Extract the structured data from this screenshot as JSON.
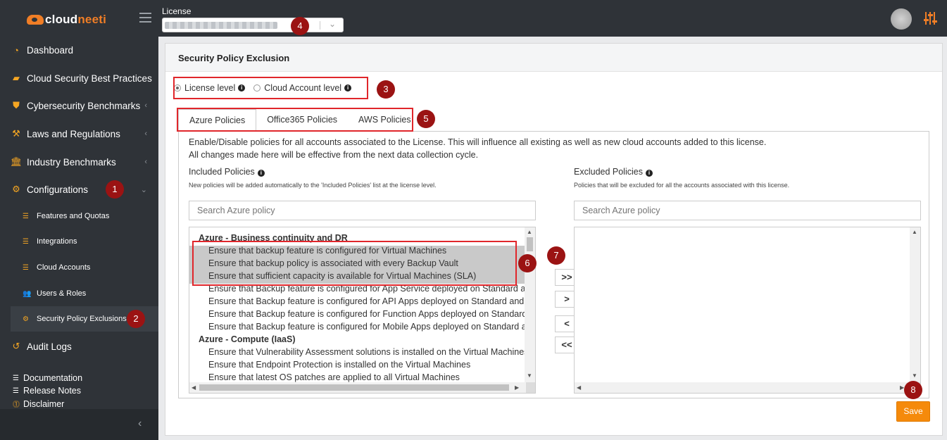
{
  "app": {
    "logo_prefix": "cloud",
    "logo_accent": "neeti"
  },
  "sidebar": {
    "items": [
      {
        "label": "Dashboard",
        "icon": "dashboard-icon"
      },
      {
        "label": "Cloud Security Best Practices",
        "icon": "briefcase-icon"
      },
      {
        "label": "Cybersecurity Benchmarks",
        "icon": "shield-icon"
      },
      {
        "label": "Laws and Regulations",
        "icon": "gavel-icon"
      },
      {
        "label": "Industry Benchmarks",
        "icon": "bank-icon"
      },
      {
        "label": "Configurations",
        "icon": "gear-icon"
      }
    ],
    "sub_items": [
      {
        "label": "Features and Quotas"
      },
      {
        "label": "Integrations"
      },
      {
        "label": "Cloud Accounts"
      },
      {
        "label": "Users & Roles"
      },
      {
        "label": "Security Policy Exclusions"
      }
    ],
    "audit": "Audit Logs",
    "links": [
      "Documentation",
      "Release Notes",
      "Disclaimer"
    ]
  },
  "topbar": {
    "license_label": "License"
  },
  "page": {
    "title": "Security Policy Exclusion",
    "level_options": [
      "License level",
      "Cloud Account level"
    ],
    "tabs": [
      "Azure Policies",
      "Office365 Policies",
      "AWS Policies"
    ],
    "description_line1": "Enable/Disable policies for all accounts associated to the License. This will influence all existing as well as new cloud accounts added to this license.",
    "description_line2": "All changes made here will be effective from the next data collection cycle.",
    "included": {
      "label": "Included Policies",
      "note": "New policies will be added automatically to the 'Included Policies' list at the license level.",
      "search_placeholder": "Search Azure policy"
    },
    "excluded": {
      "label": "Excluded Policies",
      "note": "Policies that will be excluded for all the accounts associated with this license.",
      "search_placeholder": "Search Azure policy"
    },
    "policy_rows": [
      {
        "text": "Azure - Business continuity and DR",
        "kind": "group"
      },
      {
        "text": "Ensure that backup feature is configured for Virtual Machines",
        "kind": "opt",
        "selected": true
      },
      {
        "text": "Ensure that backup policy is associated with every Backup Vault",
        "kind": "opt",
        "selected": true
      },
      {
        "text": "Ensure that sufficient capacity is available for Virtual Machines (SLA)",
        "kind": "opt",
        "selected": true
      },
      {
        "text": "Ensure that Backup feature is configured for App Service deployed on Standard and above",
        "kind": "opt"
      },
      {
        "text": "Ensure that Backup feature is configured for API Apps deployed on Standard and above",
        "kind": "opt"
      },
      {
        "text": "Ensure that Backup feature is configured for Function Apps deployed on Standard and above",
        "kind": "opt"
      },
      {
        "text": "Ensure that Backup feature is configured for Mobile Apps deployed on Standard and above",
        "kind": "opt"
      },
      {
        "text": "Azure - Compute (IaaS)",
        "kind": "group"
      },
      {
        "text": "Ensure that Vulnerability Assessment solutions is installed on the Virtual Machines",
        "kind": "opt"
      },
      {
        "text": "Ensure that Endpoint Protection is installed on the Virtual Machines",
        "kind": "opt"
      },
      {
        "text": "Ensure that latest OS patches are applied to all Virtual Machines",
        "kind": "opt"
      }
    ],
    "move_buttons": [
      ">>",
      ">",
      "<",
      "<<"
    ],
    "save_label": "Save"
  },
  "annotations": [
    "1",
    "2",
    "3",
    "4",
    "5",
    "6",
    "7",
    "8"
  ],
  "colors": {
    "accent": "#f07e26",
    "sidebar_bg": "#2f3338",
    "annotation_red": "#e0262b",
    "badge": "#9b1313"
  }
}
